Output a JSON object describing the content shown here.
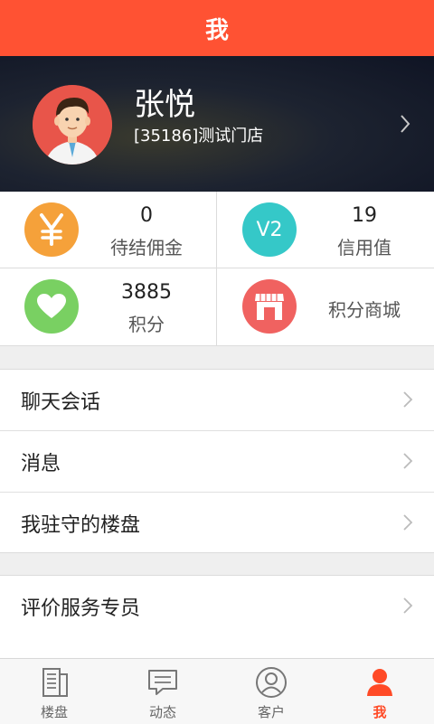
{
  "header": {
    "title": "我"
  },
  "profile": {
    "name": "张悦",
    "shop": "[35186]测试门店"
  },
  "stats": {
    "commission": {
      "value": "0",
      "label": "待结佣金",
      "icon": "yen-icon",
      "color": "#f5a13a"
    },
    "credit": {
      "value": "19",
      "label": "信用值",
      "badge": "V2",
      "icon": "level-badge-icon",
      "color": "#35c8c8"
    },
    "points": {
      "value": "3885",
      "label": "积分",
      "icon": "heart-icon",
      "color": "#79d062"
    },
    "mall": {
      "label": "积分商城",
      "icon": "store-icon",
      "color": "#f06260"
    }
  },
  "menu_group1": [
    {
      "label": "聊天会话"
    },
    {
      "label": "消息"
    },
    {
      "label": "我驻守的楼盘"
    }
  ],
  "menu_group2": [
    {
      "label": "评价服务专员"
    }
  ],
  "tabs": [
    {
      "label": "楼盘",
      "icon": "building-list-icon"
    },
    {
      "label": "动态",
      "icon": "chat-bubble-icon"
    },
    {
      "label": "客户",
      "icon": "customer-icon"
    },
    {
      "label": "我",
      "icon": "person-icon",
      "active": true
    }
  ],
  "colors": {
    "accent": "#ff5233",
    "active_tab": "#ff4a26"
  }
}
